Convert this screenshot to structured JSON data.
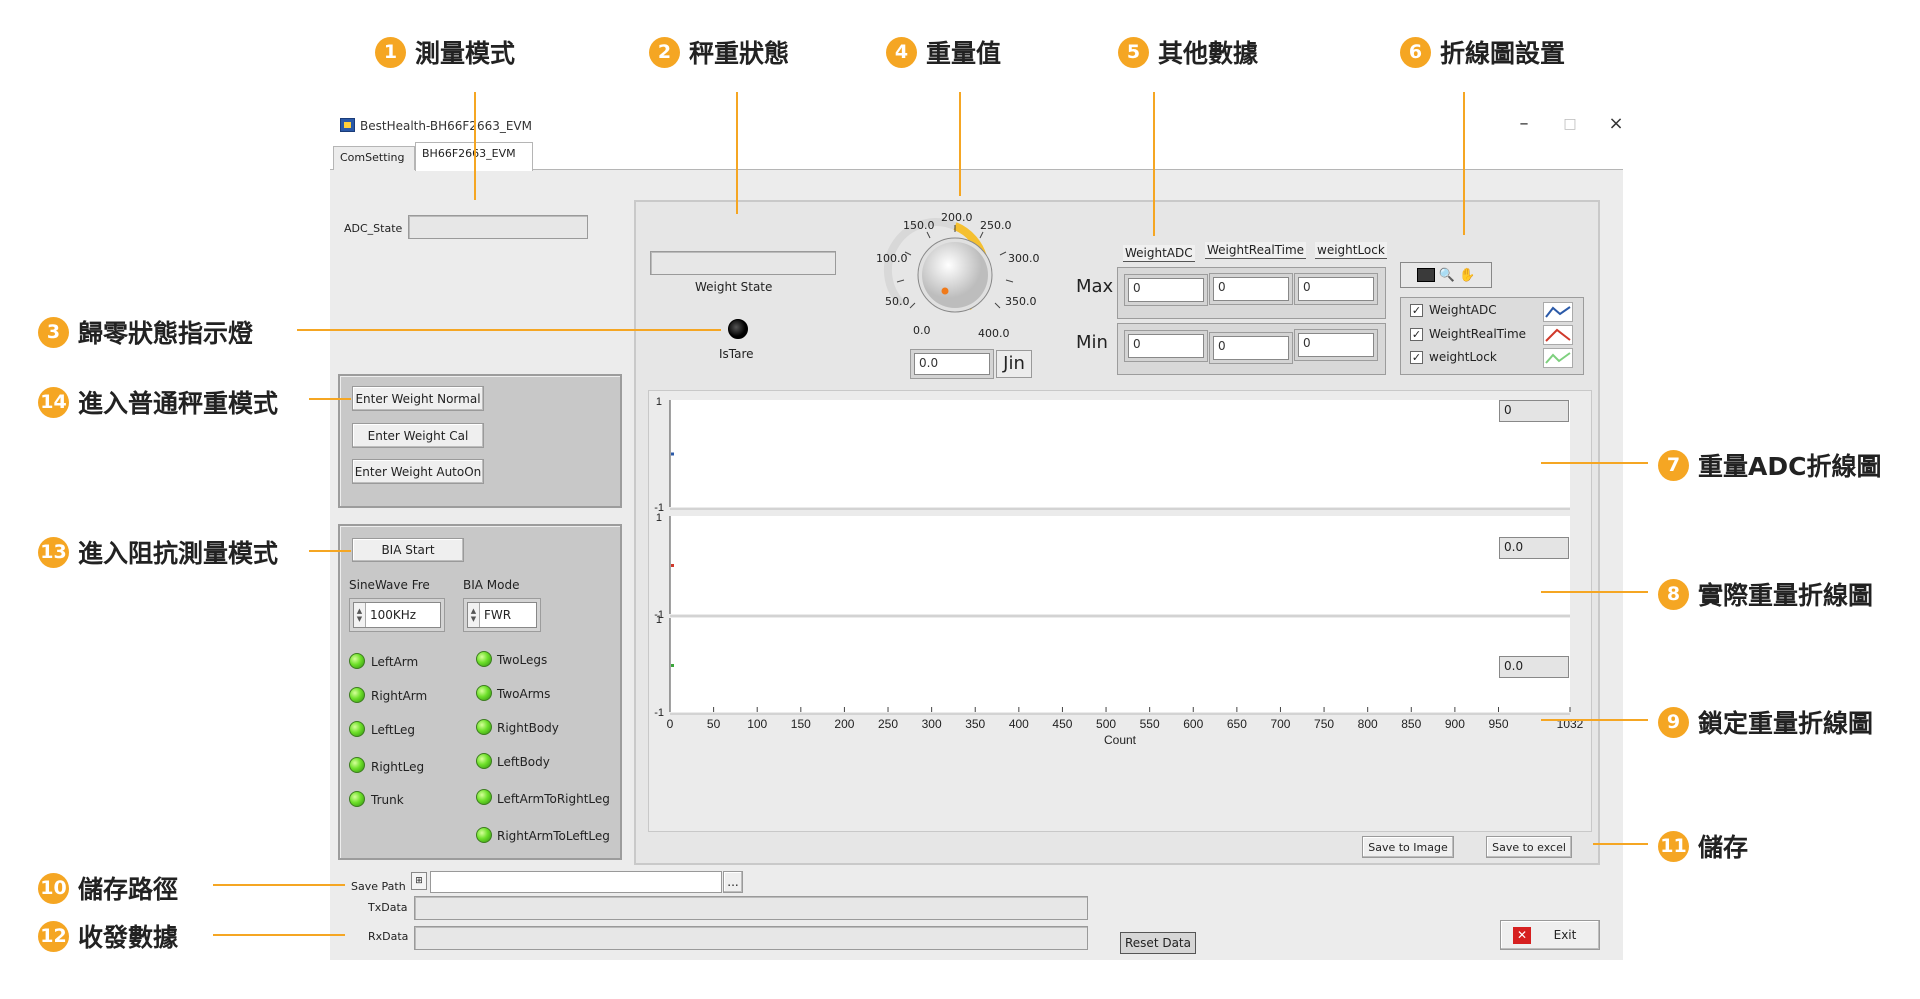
{
  "callouts": {
    "c1": {
      "num": "1",
      "label": "測量模式"
    },
    "c2": {
      "num": "2",
      "label": "秤重狀態"
    },
    "c3": {
      "num": "3",
      "label": "歸零狀態指示燈"
    },
    "c4": {
      "num": "4",
      "label": "重量值"
    },
    "c5": {
      "num": "5",
      "label": "其他數據"
    },
    "c6": {
      "num": "6",
      "label": "折線圖設置"
    },
    "c7": {
      "num": "7",
      "label": "重量ADC折線圖"
    },
    "c8": {
      "num": "8",
      "label": "實際重量折線圖"
    },
    "c9": {
      "num": "9",
      "label": "鎖定重量折線圖"
    },
    "c10": {
      "num": "10",
      "label": "儲存路徑"
    },
    "c11": {
      "num": "11",
      "label": "儲存"
    },
    "c12": {
      "num": "12",
      "label": "收發數據"
    },
    "c13": {
      "num": "13",
      "label": "進入阻抗測量模式"
    },
    "c14": {
      "num": "14",
      "label": "進入普通秤重模式"
    }
  },
  "window": {
    "title": "BestHealth-BH66F2663_EVM",
    "minimize": "–",
    "maximize": "□",
    "close": "×",
    "tabs": [
      "ComSetting",
      "BH66F2663_EVM"
    ]
  },
  "left": {
    "adc_state_label": "ADC_State",
    "weight_buttons": [
      "Enter Weight Normal",
      "Enter Weight Cal",
      "Enter Weight AutoOn"
    ],
    "bia_start": "BIA Start",
    "sinewave_label": "SineWave Fre",
    "sinewave_value": "100KHz",
    "bia_mode_label": "BIA Mode",
    "bia_mode_value": "FWR",
    "leds_left": [
      "LeftArm",
      "RightArm",
      "LeftLeg",
      "RightLeg",
      "Trunk"
    ],
    "leds_right": [
      "TwoLegs",
      "TwoArms",
      "RightBody",
      "LeftBody",
      "LeftArmToRightLeg",
      "RightArmToLeftLeg"
    ]
  },
  "top": {
    "weight_state_label": "Weight State",
    "istare_label": "IsTare",
    "dial_ticks": [
      "0.0",
      "50.0",
      "100.0",
      "150.0",
      "200.0",
      "250.0",
      "300.0",
      "350.0",
      "400.0"
    ],
    "weight_value": "0.0",
    "weight_unit": "Jin",
    "other_cols": [
      "WeightADC",
      "WeightRealTime",
      "weightLock"
    ],
    "max_label": "Max",
    "min_label": "Min",
    "max_values": [
      "0",
      "0",
      "0"
    ],
    "min_values": [
      "0",
      "0",
      "0"
    ],
    "legend": [
      "WeightADC",
      "WeightRealTime",
      "weightLock"
    ],
    "legend_checked": "✓"
  },
  "charts": {
    "readouts": [
      "0",
      "0.0",
      "0.0"
    ],
    "y_top": "1",
    "y_bottom": "-1",
    "x_label": "Count"
  },
  "chart_data": {
    "type": "line",
    "x": [
      0,
      50,
      100,
      150,
      200,
      250,
      300,
      350,
      400,
      450,
      500,
      550,
      600,
      650,
      700,
      750,
      800,
      850,
      900,
      950,
      1032
    ],
    "xlim": [
      0,
      1032
    ],
    "ylim": [
      -1,
      1
    ],
    "xlabel": "Count",
    "series": [
      {
        "name": "WeightADC",
        "color": "#2b5aa8",
        "values": [
          0
        ]
      },
      {
        "name": "WeightRealTime",
        "color": "#d0392b",
        "values": [
          0
        ]
      },
      {
        "name": "weightLock",
        "color": "#3aa63a",
        "values": [
          0
        ]
      }
    ]
  },
  "bottom": {
    "save_path_label": "Save Path",
    "browse": "...",
    "txdata_label": "TxData",
    "rxdata_label": "RxData",
    "reset_data": "Reset Data",
    "exit": "Exit",
    "save_image": "Save to Image",
    "save_excel": "Save to excel"
  },
  "colors": {
    "accent": "#f5a623",
    "led_on": "#6ee02a"
  }
}
